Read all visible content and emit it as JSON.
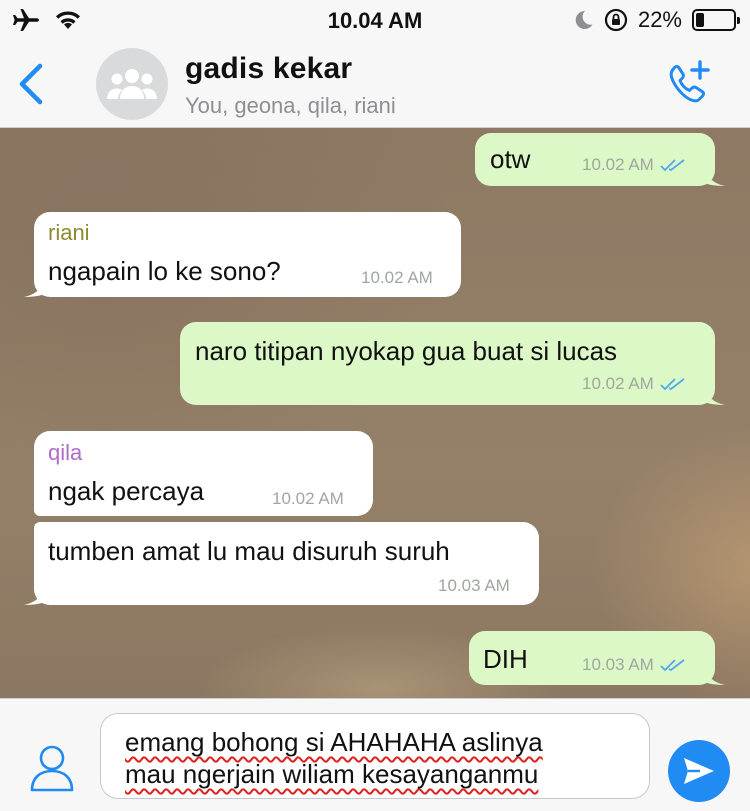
{
  "status_bar": {
    "time": "10.04 AM",
    "battery_percent": "22%",
    "battery_level": 0.22,
    "icons": [
      "airplane-icon",
      "wifi-icon",
      "moon-icon",
      "rotation-lock-icon",
      "battery-icon"
    ]
  },
  "header": {
    "title": "gadis kekar",
    "members": "You, geona, qila, riani",
    "back_icon": "chevron-left-icon",
    "call_icon": "add-call-icon"
  },
  "messages": [
    {
      "direction": "out",
      "text": "otw",
      "time": "10.02 AM",
      "read": true
    },
    {
      "direction": "in",
      "sender": "riani",
      "sender_color": "#8d8a2e",
      "text": "ngapain lo ke sono?",
      "time": "10.02 AM"
    },
    {
      "direction": "out",
      "text": "naro titipan nyokap gua buat si lucas",
      "time": "10.02 AM",
      "read": true
    },
    {
      "direction": "in",
      "sender": "qila",
      "sender_color": "#b06ac8",
      "text": "ngak percaya",
      "time": "10.02 AM"
    },
    {
      "direction": "in",
      "text": "tumben amat lu mau disuruh suruh",
      "time": "10.03 AM"
    },
    {
      "direction": "out",
      "text": "DIH",
      "time": "10.03 AM",
      "read": true
    }
  ],
  "composer": {
    "line1": "emang bohong si AHAHAHA aslinya",
    "line2": "mau ngerjain wiliam kesayanganmu",
    "send_icon": "send-icon",
    "contact_icon": "person-icon"
  },
  "colors": {
    "accent": "#1f8bf3",
    "outgoing_bubble": "#dcf8c6",
    "incoming_bubble": "#ffffff",
    "read_ticks": "#4fa9e8"
  }
}
